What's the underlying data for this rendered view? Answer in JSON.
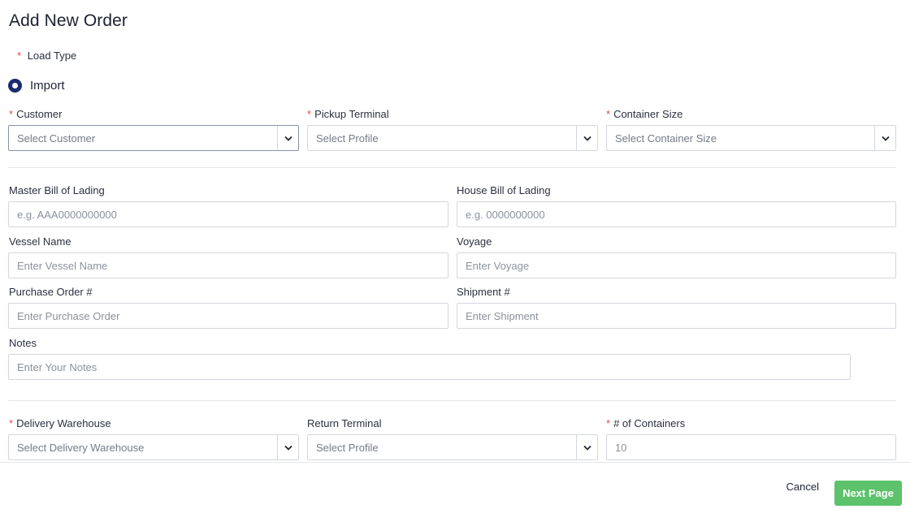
{
  "title": "Add New Order",
  "required_mark": "*",
  "load_type": {
    "label": "Load Type",
    "options": [
      {
        "label": "Import",
        "selected": true
      }
    ]
  },
  "top_selects": {
    "customer": {
      "label": "Customer",
      "placeholder": "Select Customer"
    },
    "pickup_terminal": {
      "label": "Pickup Terminal",
      "placeholder": "Select Profile"
    },
    "container_size": {
      "label": "Container Size",
      "placeholder": "Select Container Size"
    }
  },
  "fields": {
    "master_bol": {
      "label": "Master Bill of Lading",
      "placeholder": "e.g. AAA0000000000",
      "value": ""
    },
    "house_bol": {
      "label": "House Bill of Lading",
      "placeholder": "e.g. 0000000000",
      "value": ""
    },
    "vessel_name": {
      "label": "Vessel Name",
      "placeholder": "Enter Vessel Name",
      "value": ""
    },
    "voyage": {
      "label": "Voyage",
      "placeholder": "Enter Voyage",
      "value": ""
    },
    "purchase_order": {
      "label": "Purchase Order #",
      "placeholder": "Enter Purchase Order",
      "value": ""
    },
    "shipment": {
      "label": "Shipment #",
      "placeholder": "Enter Shipment",
      "value": ""
    },
    "notes": {
      "label": "Notes",
      "placeholder": "Enter Your Notes",
      "value": ""
    }
  },
  "bottom": {
    "delivery_warehouse": {
      "label": "Delivery Warehouse",
      "placeholder": "Select Delivery Warehouse"
    },
    "return_terminal": {
      "label": "Return Terminal",
      "placeholder": "Select Profile"
    },
    "num_containers": {
      "label": "# of Containers",
      "placeholder": "10",
      "value": ""
    }
  },
  "footer": {
    "cancel_label": "Cancel",
    "next_label": "Next Page"
  },
  "colors": {
    "accent_radio": "#1c2a6e",
    "required": "#e5484d",
    "next_button": "#5cc26b"
  },
  "icons": {
    "select_arrow": "chevron-down-icon"
  }
}
